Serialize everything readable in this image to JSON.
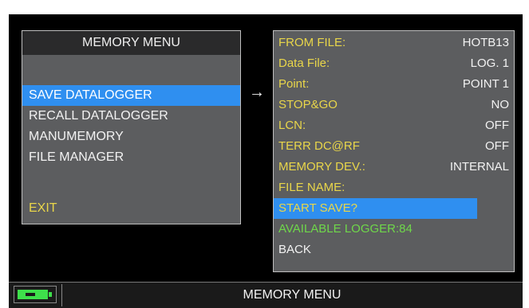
{
  "colors": {
    "label_yellow": "#e9d64a",
    "selection_blue": "#2f8ff0",
    "available_green": "#6fd84a",
    "battery_green": "#3ee04b",
    "panel_gray": "#5c5d5f"
  },
  "left_menu": {
    "title": "MEMORY MENU",
    "items": [
      {
        "label": "SAVE DATALOGGER",
        "selected": true
      },
      {
        "label": "RECALL DATALOGGER",
        "selected": false
      },
      {
        "label": "MANUMEMORY",
        "selected": false
      },
      {
        "label": "FILE MANAGER",
        "selected": false
      }
    ],
    "exit_label": "EXIT"
  },
  "arrow": "→",
  "right_panel": {
    "rows": [
      {
        "label": "FROM FILE:",
        "value": "HOTB13"
      },
      {
        "label": "Data File:",
        "value": "LOG. 1"
      },
      {
        "label": "Point:",
        "value": "POINT 1"
      },
      {
        "label": "STOP&GO",
        "value": "NO"
      },
      {
        "label": "LCN:",
        "value": "OFF"
      },
      {
        "label": "TERR DC@RF",
        "value": "OFF"
      },
      {
        "label": "MEMORY DEV.:",
        "value": "INTERNAL"
      },
      {
        "label": "FILE NAME:",
        "value": ""
      }
    ],
    "start_save": "START SAVE?",
    "available_logger": "AVAILABLE LOGGER:84",
    "back": "BACK"
  },
  "status_bar": {
    "battery_icon": "battery-charging-icon",
    "title": "MEMORY MENU"
  }
}
